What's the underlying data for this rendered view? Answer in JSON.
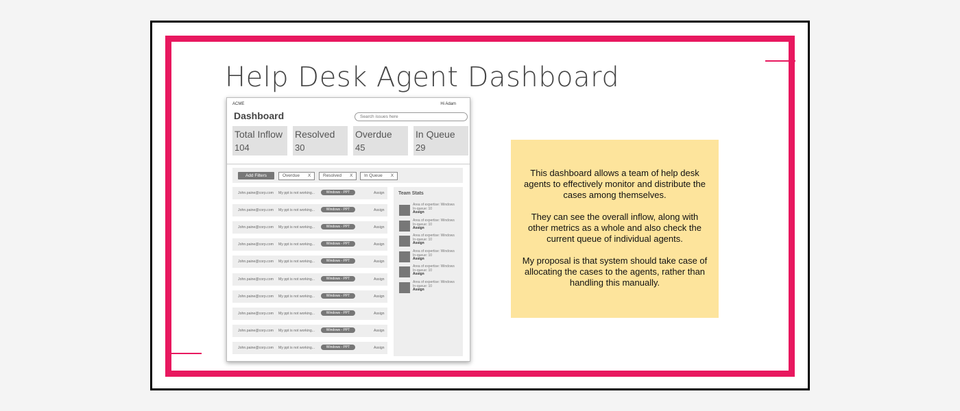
{
  "slide": {
    "title": "Help Desk Agent Dashboard"
  },
  "wireframe": {
    "brand": "ACME",
    "greeting": "Hi Adam",
    "title": "Dashboard",
    "search_placeholder": "Search issues here",
    "stats": [
      {
        "label": "Total Inflow",
        "value": "104"
      },
      {
        "label": "Resolved",
        "value": "30"
      },
      {
        "label": "Overdue",
        "value": "45"
      },
      {
        "label": "In Queue",
        "value": "29"
      }
    ],
    "filters": {
      "add_label": "Add Filters",
      "chips": [
        {
          "label": "Overdue",
          "remove": "X"
        },
        {
          "label": "Resolved",
          "remove": "X"
        },
        {
          "label": "In Queue",
          "remove": "X"
        }
      ]
    },
    "issues": [
      {
        "email": "John.paine@corp.com",
        "issue": "My ppt is not working...",
        "tag": "Windows - PPT",
        "action": "Assign"
      },
      {
        "email": "John.paine@corp.com",
        "issue": "My ppt is not working...",
        "tag": "Windows - PPT",
        "action": "Assign"
      },
      {
        "email": "John.paine@corp.com",
        "issue": "My ppt is not working...",
        "tag": "Windows - PPT",
        "action": "Assign"
      },
      {
        "email": "John.paine@corp.com",
        "issue": "My ppt is not working...",
        "tag": "Windows - PPT",
        "action": "Assign"
      },
      {
        "email": "John.paine@corp.com",
        "issue": "My ppt is not working...",
        "tag": "Windows - PPT",
        "action": "Assign"
      },
      {
        "email": "John.paine@corp.com",
        "issue": "My ppt is not working...",
        "tag": "Windows - PPT",
        "action": "Assign"
      },
      {
        "email": "John.paine@corp.com",
        "issue": "My ppt is not working...",
        "tag": "Windows - PPT",
        "action": "Assign"
      },
      {
        "email": "John.paine@corp.com",
        "issue": "My ppt is not working...",
        "tag": "Windows - PPT",
        "action": "Assign"
      },
      {
        "email": "John.paine@corp.com",
        "issue": "My ppt is not working...",
        "tag": "Windows - PPT",
        "action": "Assign"
      },
      {
        "email": "John.paine@corp.com",
        "issue": "My ppt is not working...",
        "tag": "Windows - PPT",
        "action": "Assign"
      }
    ],
    "team_stats": {
      "title": "Team Stats",
      "agents": [
        {
          "expertise": "Area of expertise: Windows",
          "queue": "In-queue: 10",
          "action": "Assign"
        },
        {
          "expertise": "Area of expertise: Windows",
          "queue": "In-queue: 10",
          "action": "Assign"
        },
        {
          "expertise": "Area of expertise: Windows",
          "queue": "In-queue: 10",
          "action": "Assign"
        },
        {
          "expertise": "Area of expertise: Windows",
          "queue": "In-queue: 10",
          "action": "Assign"
        },
        {
          "expertise": "Area of expertise: Windows",
          "queue": "In-queue: 10",
          "action": "Assign"
        },
        {
          "expertise": "Area of expertise: Windows",
          "queue": "In-queue: 10",
          "action": "Assign"
        }
      ]
    }
  },
  "note": {
    "paragraphs": [
      "This dashboard allows a team of help desk agents to effectively monitor and distribute the cases among themselves.",
      "They can see the overall inflow, along with other metrics as a whole and also check the current queue of individual agents.",
      "My proposal is that system should take case of allocating the cases to the agents, rather than handling this manually."
    ]
  },
  "colors": {
    "accent": "#e8185f",
    "note_bg": "#fde49c",
    "wire_gray": "#777777"
  }
}
